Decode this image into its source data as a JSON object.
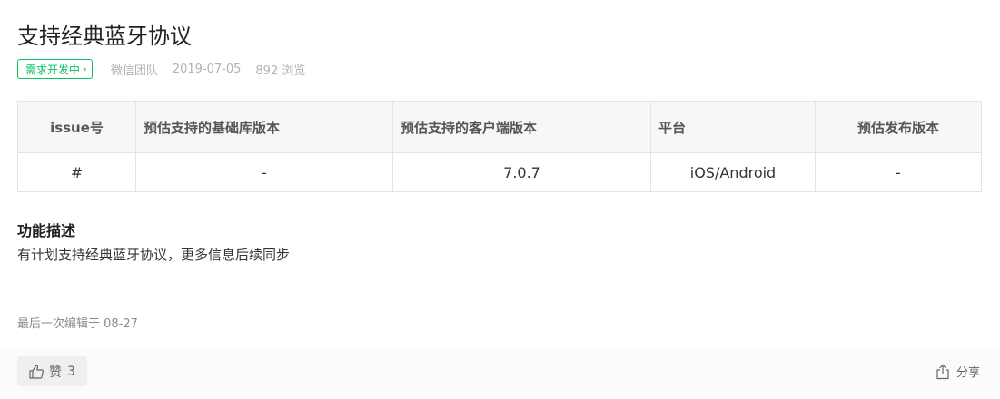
{
  "title": "支持经典蓝牙协议",
  "meta": {
    "status": "需求开发中",
    "status_chevron": "›",
    "author": "微信团队",
    "date": "2019-07-05",
    "views": "892 浏览"
  },
  "table": {
    "headers": [
      "issue号",
      "预估支持的基础库版本",
      "预估支持的客户端版本",
      "平台",
      "预估发布版本"
    ],
    "rows": [
      [
        "#",
        "-",
        "7.0.7",
        "iOS/Android",
        "-"
      ]
    ]
  },
  "section": {
    "title": "功能描述",
    "body": "有计划支持经典蓝牙协议，更多信息后续同步"
  },
  "edited": "最后一次编辑于  08-27",
  "footer": {
    "like_label": "赞",
    "like_count": "3",
    "share_label": "分享"
  },
  "colors": {
    "accent": "#07c160",
    "muted": "#b2b2b2"
  },
  "icons": {
    "like": "thumbs-up-icon",
    "share": "share-icon"
  }
}
